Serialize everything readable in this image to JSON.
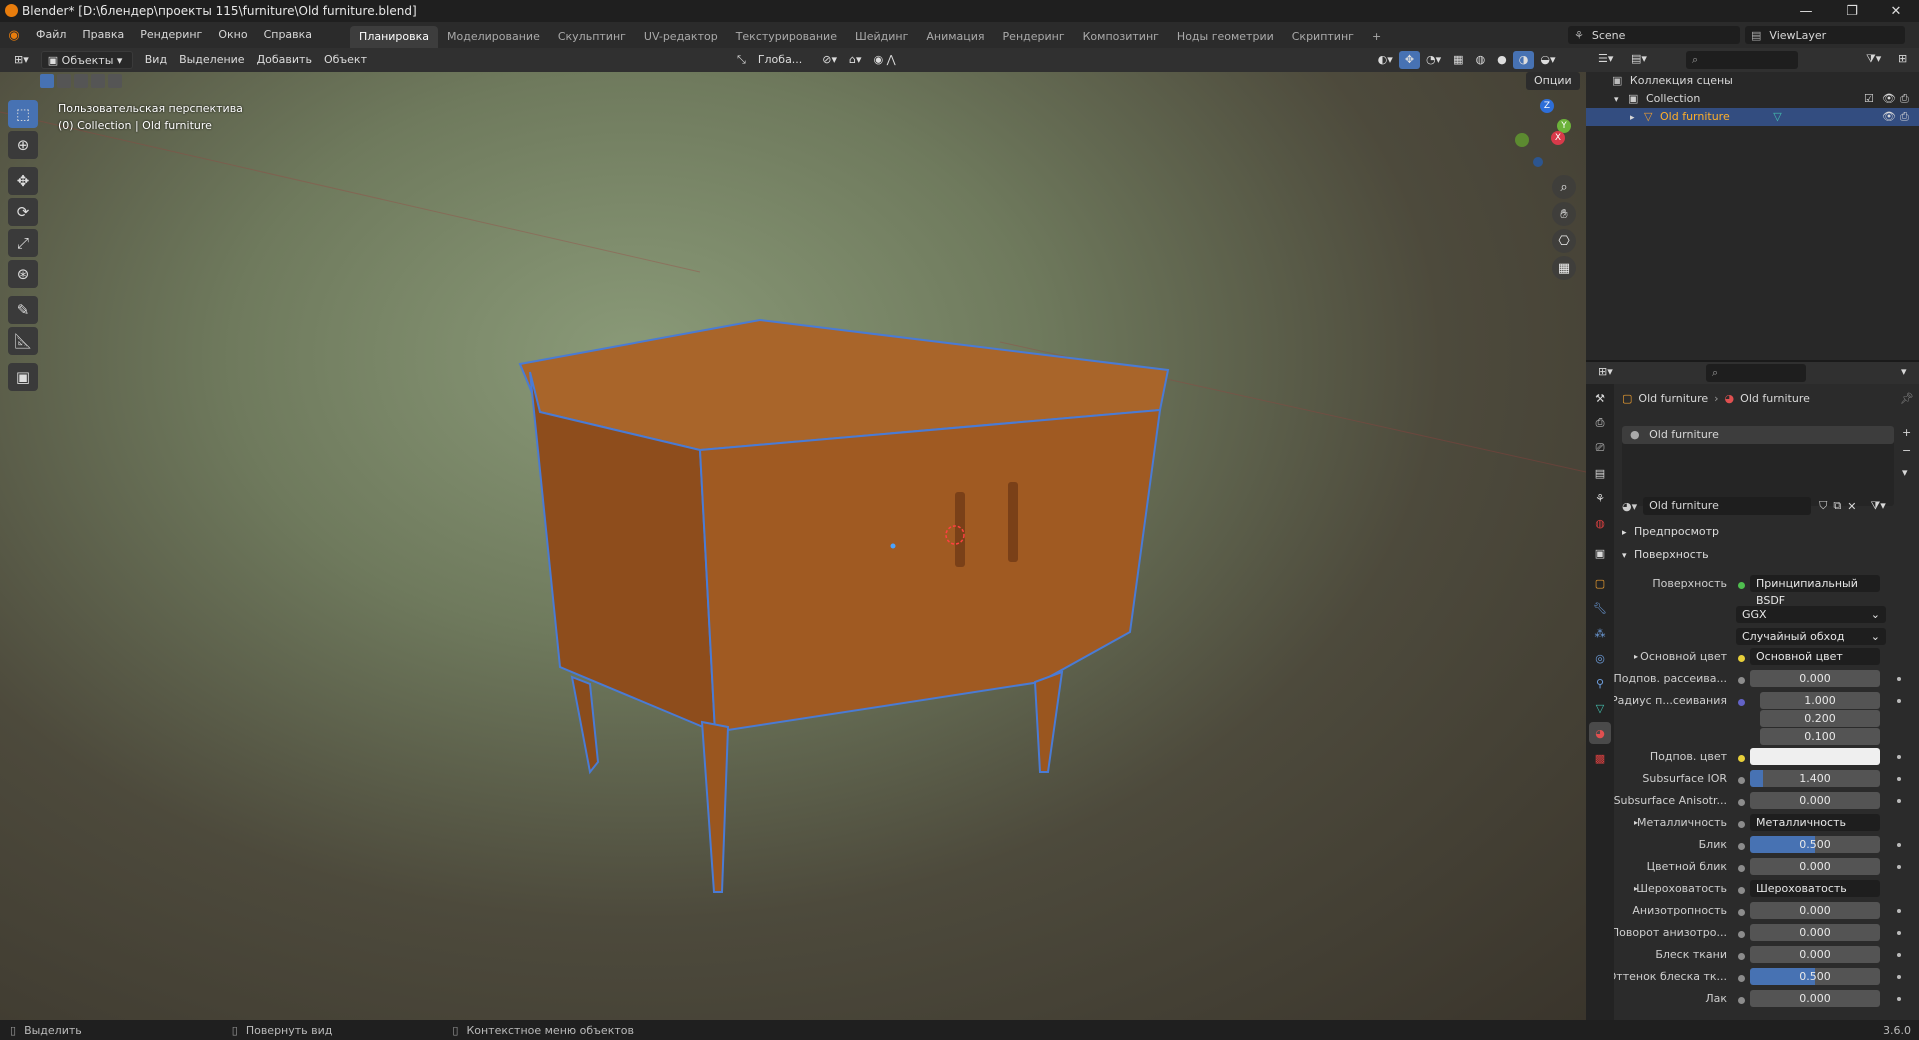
{
  "window": {
    "title": "Blender* [D:\\блендер\\проекты 115\\furniture\\Old furniture.blend]",
    "minimize": "—",
    "maximize": "❐",
    "close": "✕"
  },
  "menus": [
    "Файл",
    "Правка",
    "Рендеринг",
    "Окно",
    "Справка"
  ],
  "workspaces": [
    "Планировка",
    "Моделирование",
    "Скульптинг",
    "UV-редактор",
    "Текстурирование",
    "Шейдинг",
    "Анимация",
    "Рендеринг",
    "Композитинг",
    "Ноды геометрии",
    "Скриптинг",
    "+"
  ],
  "scene": {
    "name": "Scene",
    "view_layer": "ViewLayer"
  },
  "viewport_header": {
    "mode": "Объекты",
    "menus": [
      "Вид",
      "Выделение",
      "Добавить",
      "Объект"
    ],
    "orientation": "Глоба...",
    "options": "Опции"
  },
  "viewport": {
    "perspective": "Пользовательская перспектива",
    "collection_info": "(0) Collection | Old furniture",
    "gizmo": {
      "z": "Z",
      "y": "Y",
      "x": "X"
    }
  },
  "outliner": {
    "root": "Коллекция сцены",
    "collection": "Collection",
    "object": "Old furniture"
  },
  "properties": {
    "breadcrumb_object": "Old furniture",
    "breadcrumb_material": "Old furniture",
    "slot": "Old furniture",
    "material_name": "Old furniture",
    "panel_preview": "Предпросмотр",
    "panel_surface": "Поверхность",
    "surface_label": "Поверхность",
    "surface_value": "Принципиальный BSDF",
    "distribution": "GGX",
    "subsurface_method": "Случайный обход",
    "rows": [
      {
        "label": "Основной цвет",
        "value": "Основной цвет",
        "kind": "link"
      },
      {
        "label": "Подпов. рассеива...",
        "value": "0.000",
        "kind": "num"
      },
      {
        "label": "Радиус п...сеивания",
        "value": "1.000",
        "kind": "num"
      },
      {
        "label": "",
        "value": "0.200",
        "kind": "num"
      },
      {
        "label": "",
        "value": "0.100",
        "kind": "num"
      },
      {
        "label": "Подпов. цвет",
        "value": "",
        "kind": "color"
      },
      {
        "label": "Subsurface IOR",
        "value": "1.400",
        "kind": "num"
      },
      {
        "label": "Subsurface Anisotr...",
        "value": "0.000",
        "kind": "num"
      },
      {
        "label": "Металличность",
        "value": "Металличность",
        "kind": "link"
      },
      {
        "label": "Блик",
        "value": "0.500",
        "kind": "blue"
      },
      {
        "label": "Цветной блик",
        "value": "0.000",
        "kind": "num"
      },
      {
        "label": "Шероховатость",
        "value": "Шероховатость",
        "kind": "link"
      },
      {
        "label": "Анизотропность",
        "value": "0.000",
        "kind": "num"
      },
      {
        "label": "Поворот анизотро...",
        "value": "0.000",
        "kind": "num"
      },
      {
        "label": "Блеск ткани",
        "value": "0.000",
        "kind": "num"
      },
      {
        "label": "Оттенок блеска тк...",
        "value": "0.500",
        "kind": "blue"
      },
      {
        "label": "Лак",
        "value": "0.000",
        "kind": "num"
      }
    ]
  },
  "statusbar": {
    "select": "Выделить",
    "rotate": "Повернуть вид",
    "context": "Контекстное меню объектов",
    "version": "3.6.0"
  }
}
